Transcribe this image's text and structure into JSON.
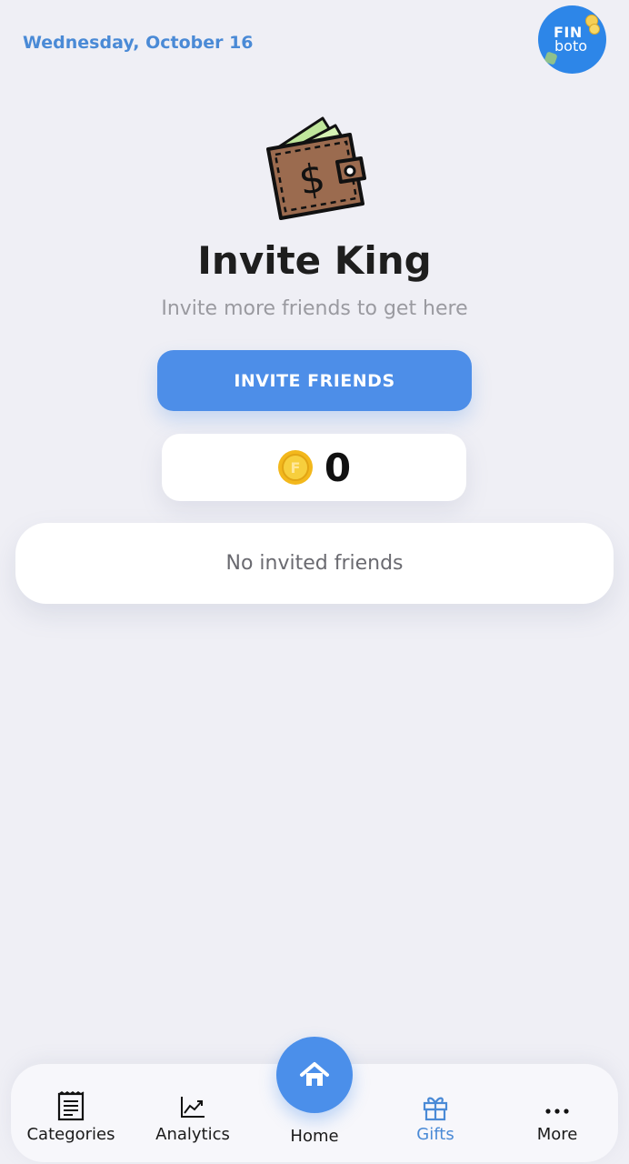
{
  "header": {
    "date": "Wednesday, October 16",
    "logo_top": "FIN",
    "logo_bottom": "boto"
  },
  "hero": {
    "icon": "wallet-icon",
    "title": "Invite King",
    "subtitle": "Invite more friends to get here"
  },
  "invite_button": {
    "label": "INVITE FRIENDS"
  },
  "coins": {
    "icon": "coin-icon",
    "count": "0"
  },
  "friends": {
    "empty_text": "No invited friends"
  },
  "tabbar": {
    "items": [
      {
        "label": "Categories",
        "icon": "receipt-icon"
      },
      {
        "label": "Analytics",
        "icon": "chart-line-icon"
      },
      {
        "label": "Home",
        "icon": "home-icon"
      },
      {
        "label": "Gifts",
        "icon": "gift-icon"
      },
      {
        "label": "More",
        "icon": "more-dots-icon"
      }
    ],
    "active": "Gifts"
  },
  "colors": {
    "accent": "#4a8ad6",
    "button": "#4d8ee8",
    "background": "#efeff5"
  }
}
